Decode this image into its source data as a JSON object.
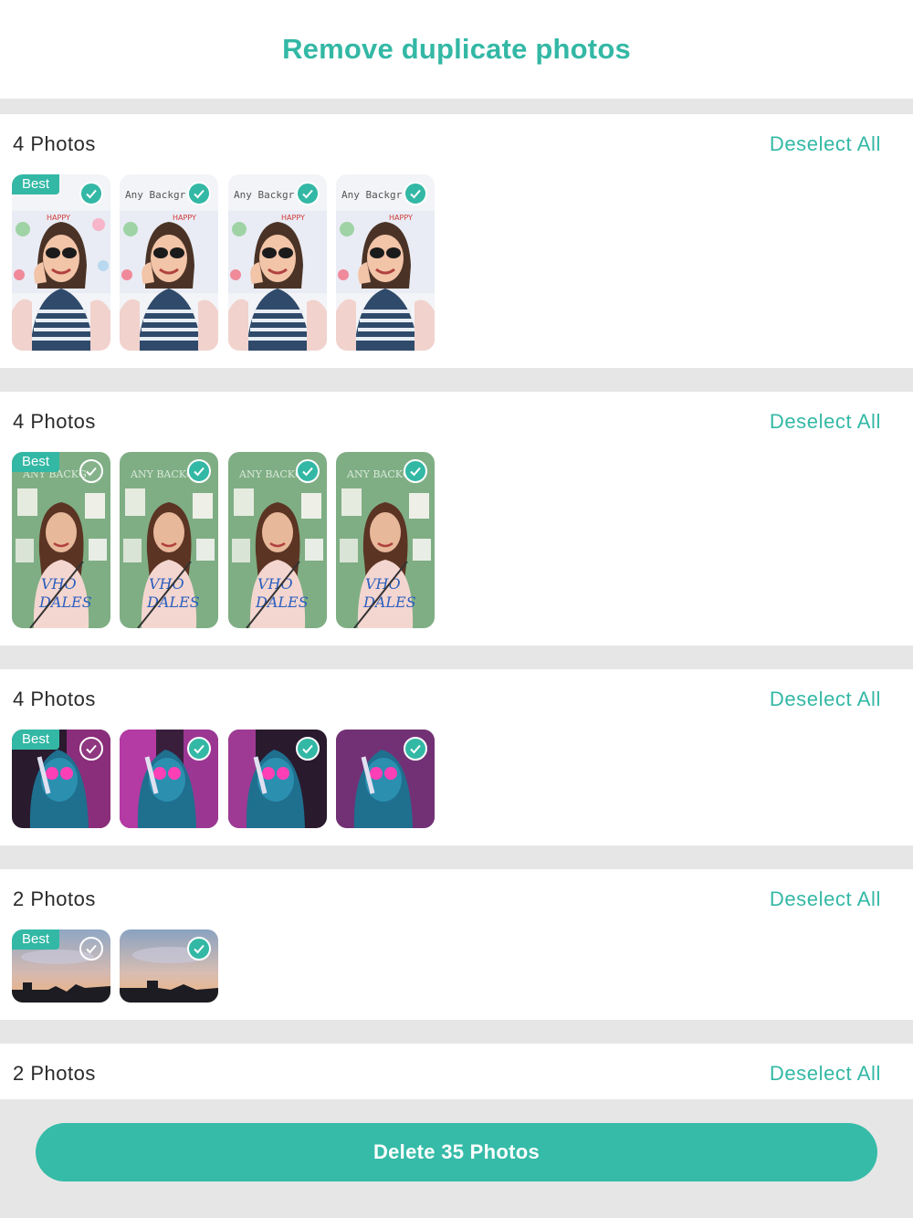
{
  "header": {
    "title": "Remove duplicate photos"
  },
  "best_badge": "Best",
  "deselect_label": "Deselect All",
  "groups": [
    {
      "count_label": "4 Photos",
      "theme": "sunglasses",
      "checks": [
        "on",
        "on",
        "on",
        "on"
      ]
    },
    {
      "count_label": "4 Photos",
      "theme": "green-collage",
      "checks": [
        "off",
        "on",
        "on",
        "on"
      ]
    },
    {
      "count_label": "4 Photos",
      "theme": "neon-portrait",
      "checks": [
        "off",
        "on",
        "on",
        "on"
      ]
    },
    {
      "count_label": "2 Photos",
      "theme": "sunset-sky",
      "checks": [
        "off",
        "on"
      ]
    },
    {
      "count_label": "2 Photos",
      "theme": "hidden",
      "checks": []
    }
  ],
  "photo_text": {
    "sunglasses_line1": "Any Backgr",
    "sunglasses_line2": "HAPPY",
    "green_line1": "ANY BACKG"
  },
  "delete_button": {
    "label": "Delete 35 Photos"
  },
  "colors": {
    "accent": "#33b8a5",
    "background": "#e6e6e6"
  }
}
